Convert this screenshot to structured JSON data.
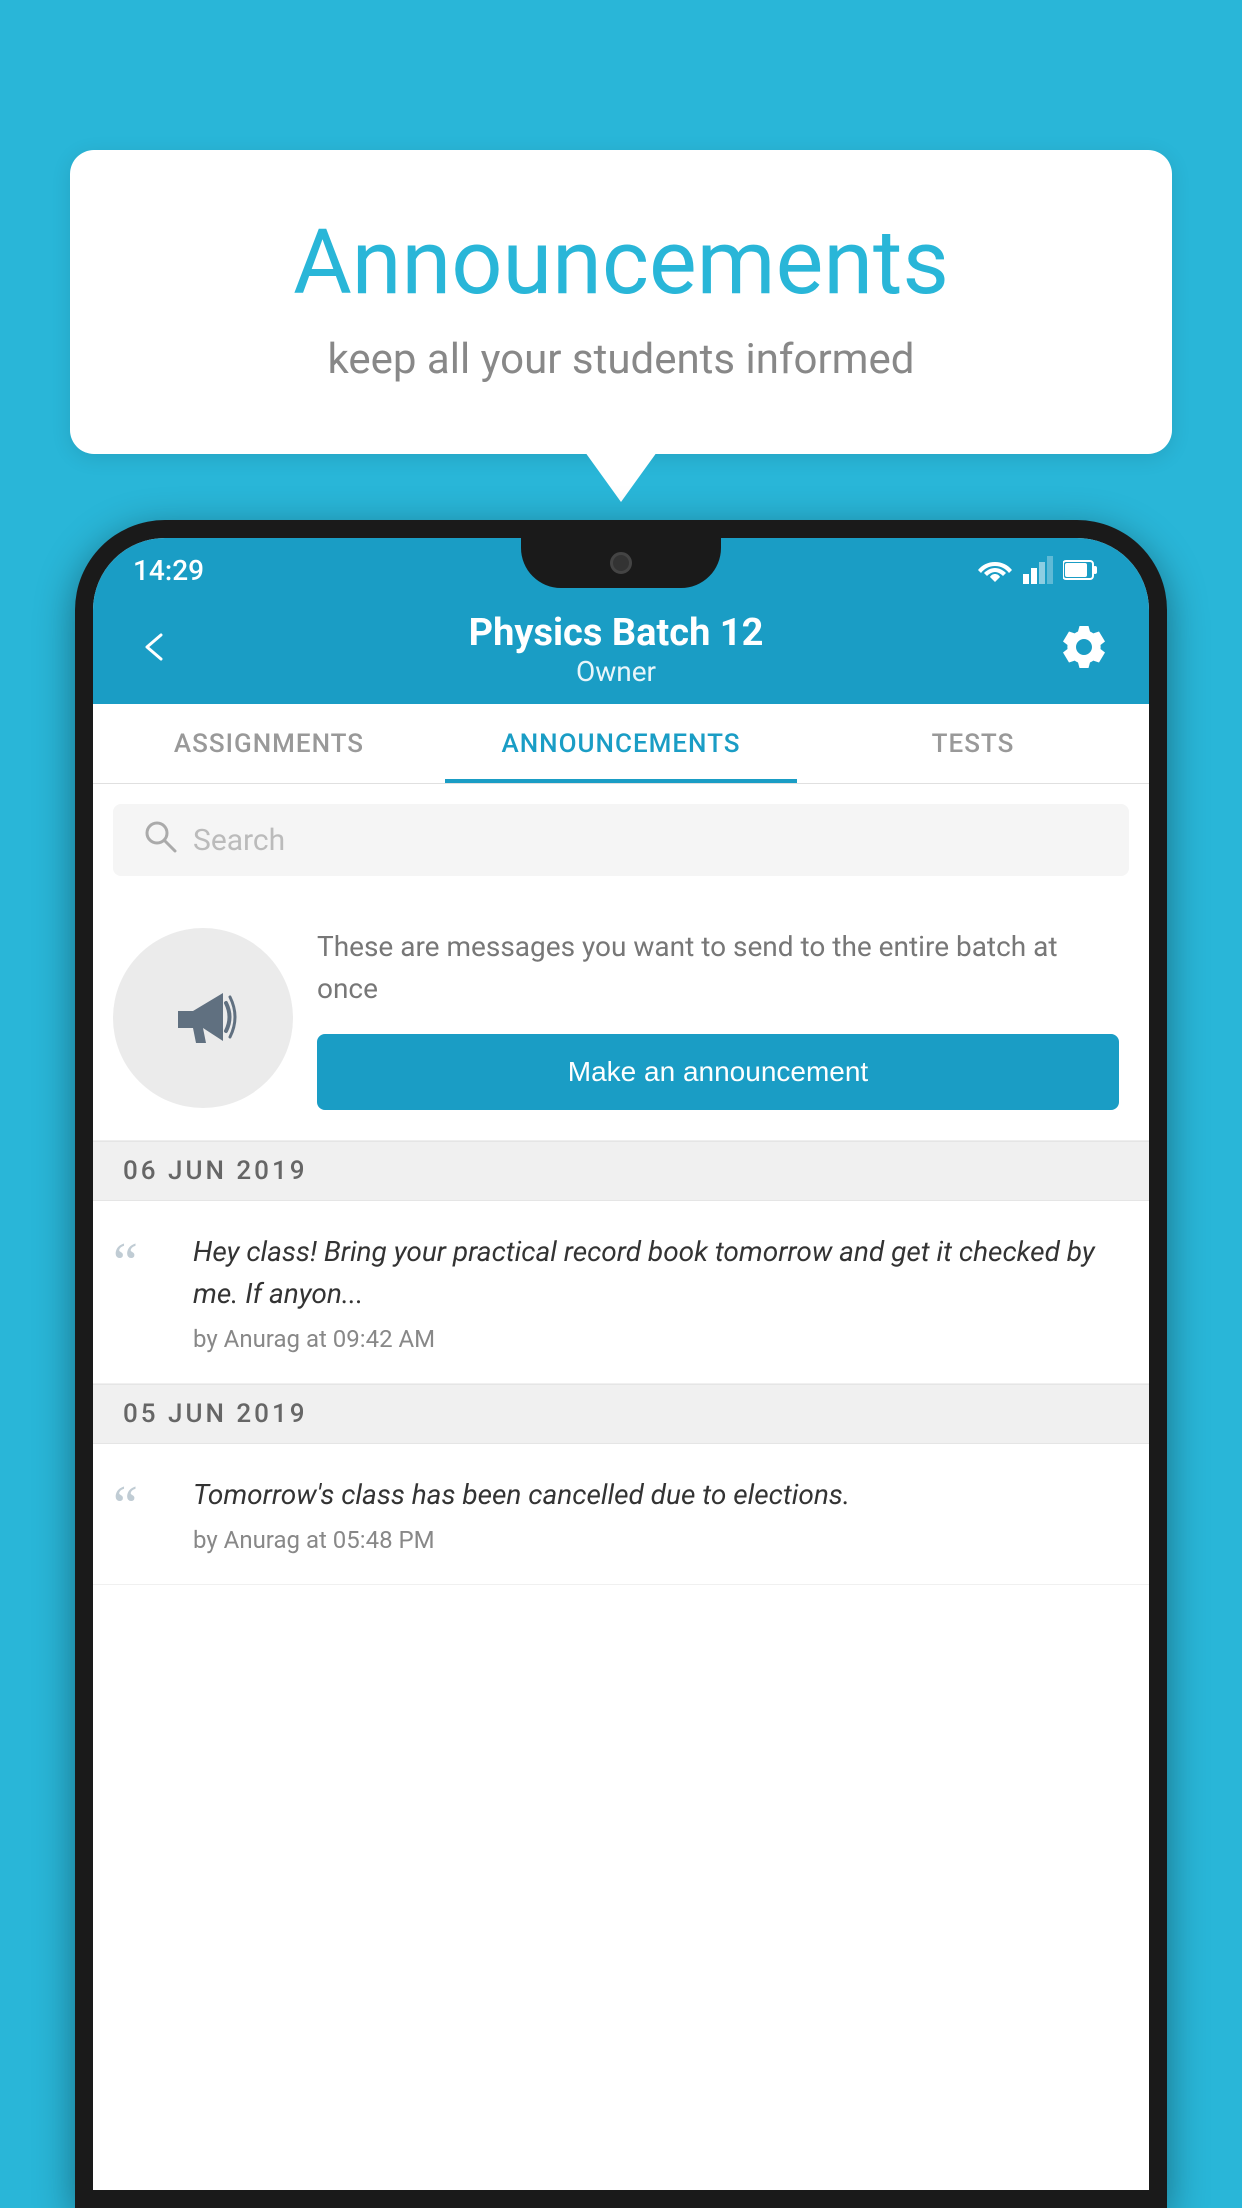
{
  "background_color": "#29b6d8",
  "bubble": {
    "title": "Announcements",
    "subtitle": "keep all your students informed"
  },
  "status_bar": {
    "time": "14:29"
  },
  "app_bar": {
    "title": "Physics Batch 12",
    "subtitle": "Owner"
  },
  "tabs": [
    {
      "label": "ASSIGNMENTS",
      "active": false
    },
    {
      "label": "ANNOUNCEMENTS",
      "active": true
    },
    {
      "label": "TESTS",
      "active": false
    },
    {
      "label": "•••",
      "active": false
    }
  ],
  "search": {
    "placeholder": "Search"
  },
  "promo": {
    "description": "These are messages you want to send to the entire batch at once",
    "button_label": "Make an announcement"
  },
  "date_groups": [
    {
      "date": "06  JUN  2019",
      "announcements": [
        {
          "text": "Hey class! Bring your practical record book tomorrow and get it checked by me. If anyon...",
          "meta": "by Anurag at 09:42 AM"
        }
      ]
    },
    {
      "date": "05  JUN  2019",
      "announcements": [
        {
          "text": "Tomorrow's class has been cancelled due to elections.",
          "meta": "by Anurag at 05:48 PM"
        }
      ]
    }
  ]
}
